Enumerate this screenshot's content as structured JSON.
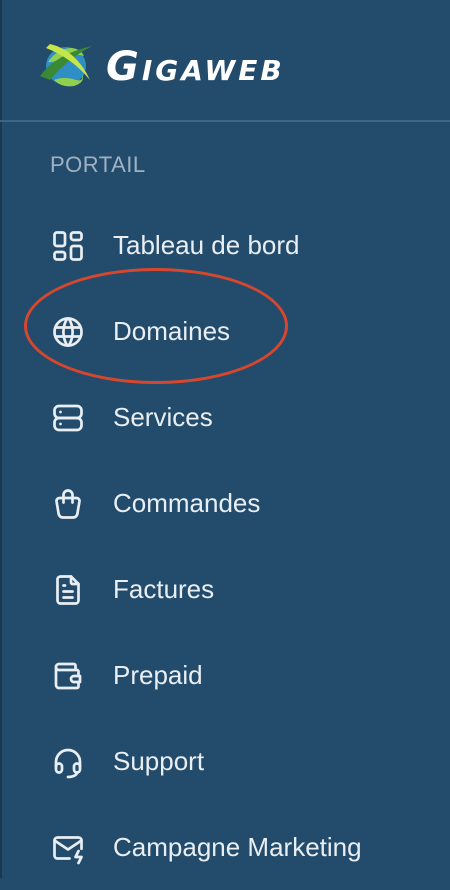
{
  "brand": {
    "name": "Gigaweb",
    "logo_icon": "globe-logo-icon"
  },
  "colors": {
    "sidebar_bg": "#234c6c",
    "text": "#e9eef3",
    "section_label": "#9fb2c3",
    "highlight": "#d6472e"
  },
  "sidebar": {
    "section_label": "PORTAIL",
    "items": [
      {
        "label": "Tableau de bord",
        "icon": "dashboard-icon"
      },
      {
        "label": "Domaines",
        "icon": "globe-icon"
      },
      {
        "label": "Services",
        "icon": "server-icon"
      },
      {
        "label": "Commandes",
        "icon": "shopping-bag-icon"
      },
      {
        "label": "Factures",
        "icon": "invoice-icon"
      },
      {
        "label": "Prepaid",
        "icon": "wallet-icon"
      },
      {
        "label": "Support",
        "icon": "headset-icon"
      },
      {
        "label": "Campagne Marketing",
        "icon": "mail-bolt-icon"
      }
    ]
  }
}
